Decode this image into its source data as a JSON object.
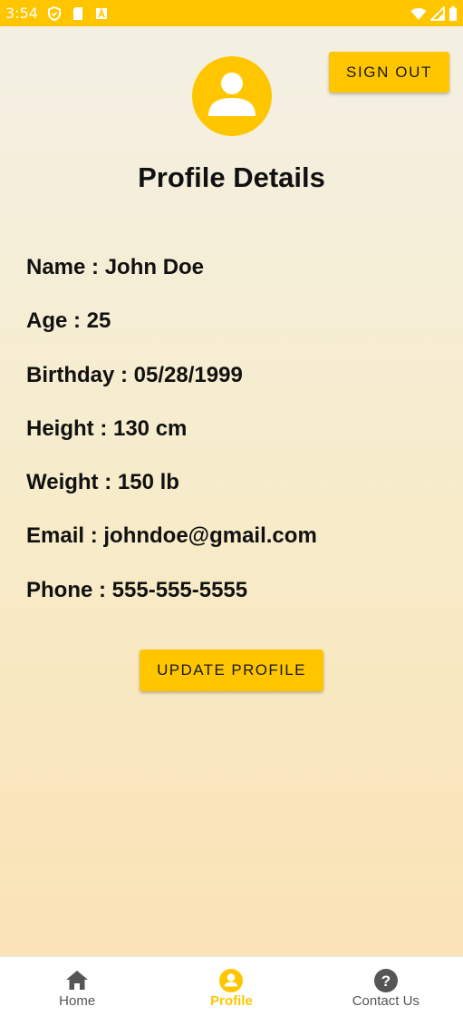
{
  "status_bar": {
    "time": "3:54",
    "icons": [
      "shield-icon",
      "sd-card-icon",
      "a-badge-icon",
      "wifi-icon",
      "signal-icon",
      "battery-icon"
    ]
  },
  "colors": {
    "accent": "#ffc600",
    "text": "#111111",
    "nav_inactive": "#555555"
  },
  "header": {
    "avatar_icon": "account-circle-icon",
    "sign_out_label": "SIGN OUT",
    "title": "Profile Details"
  },
  "profile": {
    "name": "Name : John Doe",
    "age": "Age : 25",
    "birthday": "Birthday : 05/28/1999",
    "height": "Height : 130 cm",
    "weight": "Weight : 150 lb",
    "email": "Email : johndoe@gmail.com",
    "phone": "Phone : 555-555-5555"
  },
  "actions": {
    "update_label": "UPDATE PROFILE"
  },
  "bottom_nav": {
    "items": [
      {
        "label": "Home",
        "icon": "home-icon",
        "active": false
      },
      {
        "label": "Profile",
        "icon": "account-circle-icon",
        "active": true
      },
      {
        "label": "Contact Us",
        "icon": "help-circle-icon",
        "active": false
      }
    ]
  }
}
